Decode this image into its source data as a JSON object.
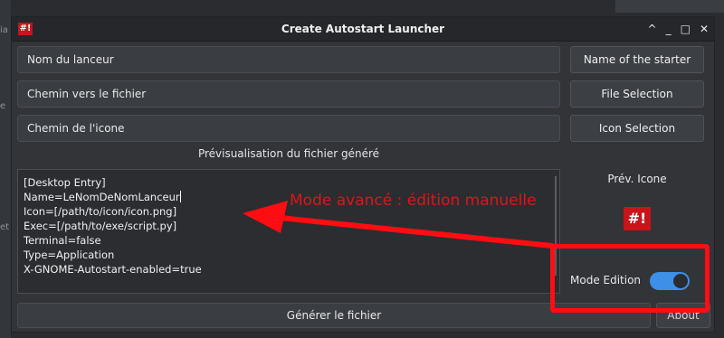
{
  "window": {
    "logo_text": "#!",
    "title": "Create Autostart Launcher",
    "controls": [
      "^",
      "_",
      "□",
      "✕"
    ]
  },
  "background": {
    "labels": [
      "ia",
      "e",
      "et"
    ]
  },
  "fields": {
    "name": "Nom du lanceur",
    "file_path": "Chemin vers le fichier",
    "icon_path": "Chemin de l'icone"
  },
  "buttons": {
    "name_starter": "Name of the starter",
    "file_selection": "File Selection",
    "icon_selection": "Icon Selection",
    "generate": "Générer le fichier",
    "about": "About"
  },
  "preview": {
    "title": "Prévisualisation du fichier généré",
    "lines": [
      "[Desktop Entry]",
      "Name=LeNomDeNomLanceur",
      "Icon=[/path/to/icon/icon.png]",
      "Exec=[/path/to/exe/script.py]",
      "Terminal=false",
      "Type=Application",
      "X-GNOME-Autostart-enabled=true"
    ]
  },
  "icon_preview": {
    "label": "Prév. Icone",
    "glyph": "#!"
  },
  "mode": {
    "label": "Mode Edition",
    "enabled": true,
    "accent": "#3d8fe8"
  },
  "annotation": {
    "text": "Mode avancé : édition manuelle",
    "color": "#ff0d12"
  }
}
